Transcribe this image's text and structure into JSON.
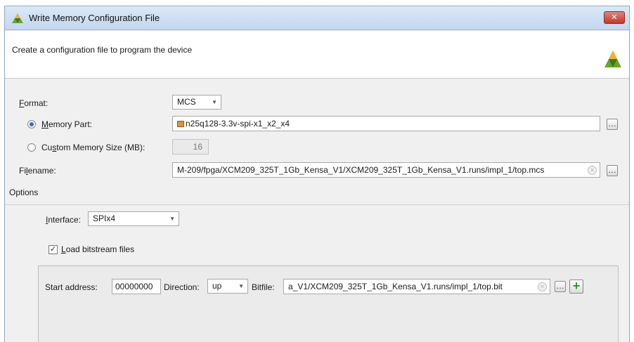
{
  "window": {
    "title": "Write Memory Configuration File",
    "close_label": "✕"
  },
  "header": {
    "description": "Create a configuration file to program the device"
  },
  "format": {
    "label_accel": "F",
    "label_rest": "ormat:",
    "value": "MCS"
  },
  "memory_part": {
    "label_accel": "M",
    "label_rest": "emory Part:",
    "value": "n25q128-3.3v-spi-x1_x2_x4",
    "selected": true
  },
  "custom_memory": {
    "label_pre": "Cu",
    "label_accel": "s",
    "label_rest": "tom Memory Size (MB):",
    "value": "16"
  },
  "filename": {
    "label_pre": "Fi",
    "label_accel": "l",
    "label_rest": "ename:",
    "value": "M-209/fpga/XCM209_325T_1Gb_Kensa_V1/XCM209_325T_1Gb_Kensa_V1.runs/impl_1/top.mcs"
  },
  "options": {
    "section_label": "Options",
    "interface": {
      "label_accel": "I",
      "label_rest": "nterface:",
      "value": "SPIx4"
    },
    "load_bitstream": {
      "label_accel": "L",
      "label_rest": "oad bitstream files",
      "checked": true
    }
  },
  "bitstream_row": {
    "start_address_label": "Start address:",
    "start_address_value": "00000000",
    "direction_label": "Direction:",
    "direction_value": "up",
    "bitfile_label": "Bitfile:",
    "bitfile_value": "a_V1/XCM209_325T_1Gb_Kensa_V1.runs/impl_1/top.bit"
  },
  "glyphs": {
    "browse": "…",
    "plus": "+",
    "check": "✓",
    "clear": "×",
    "dropdown": "▼"
  },
  "colors": {
    "accent_green": "#2f9a2f",
    "close_red": "#c0392b",
    "title_bg": "#c4d7ef"
  }
}
